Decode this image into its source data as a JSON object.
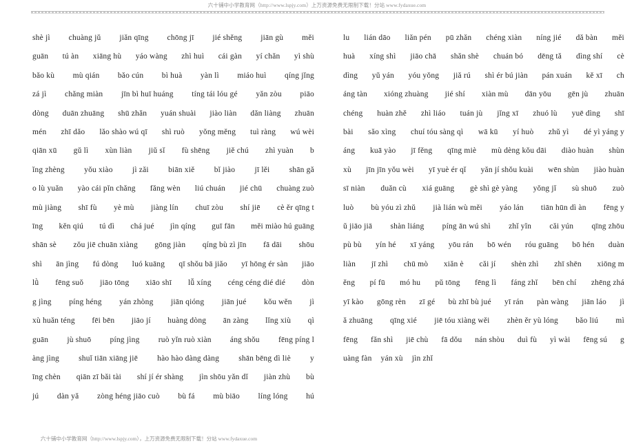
{
  "document": {
    "type": "pinyin-word-list",
    "header_banner": "六十铺中小学教育网（http://www.lspjy.com）上万资源免费无限制下载！分站 www.fydaxue.com",
    "footer_banner": "六十铺中小学教育网（http://www.lspjy.com），上万资源免费无限制下载！分站 www.fydaxue.com"
  },
  "columns": {
    "left": {
      "lines": [
        [
          "shè jì",
          "chuàng jǔ",
          "jiǎn qīng",
          "chōng jī",
          "jié shěng",
          "jiān gù",
          "měi"
        ],
        [
          "guān",
          "tú àn",
          "xiāng hù",
          "yáo wàng",
          "zhì huì",
          "cái gàn",
          "yí chǎn",
          "yì shù"
        ],
        [
          "bǎo kù",
          "mù qián",
          "bǎo cún",
          "bì huà",
          "yàn lì",
          "miáo huì",
          "qíng jǐng"
        ],
        [
          "zá jì",
          "chǎng miàn",
          "jīn bì huī huáng",
          "tíng tái lóu gé",
          "yǎn zòu",
          "piāo"
        ],
        [
          "dòng",
          "duān zhuāng",
          "shū zhǎn",
          "yuán shuài",
          "jiào liàn",
          "dǎn liàng",
          "zhuān"
        ],
        [
          "mén",
          "zhī dǎo",
          "lǎo shào wú qī",
          "shì ruò",
          "yǒng měng",
          "tuì ràng",
          "wú wèi"
        ],
        [
          "qiān xū",
          "gǔ lì",
          "xùn liàn",
          "jiǔ sǐ",
          "fù shēng",
          "jiě chú",
          "zhì yuàn",
          "b"
        ],
        [
          "ǐng zhèng",
          "yǒu xiào",
          "jì zǎi",
          "biān xiě",
          "bǐ jiào",
          "jī lěi",
          "shān gǎ"
        ],
        [
          "o lù yuǎn",
          "yào cái pǐn chǎng",
          "fǎng wèn",
          "liú chuán",
          "jié chū",
          "chuàng zuò"
        ],
        [
          "mù jiàng",
          "shī fù",
          "yè mù",
          "jiàng lín",
          "chuī zòu",
          "shí jiē",
          "cè ěr qīng t"
        ],
        [
          "īng",
          "kěn qiú",
          "tú dì",
          "chá jué",
          "jìn qíng",
          "guī fān",
          "měi miào hú guāng"
        ],
        [
          "shān sè",
          "zǒu jiē chuān xiàng",
          "gōng jiàn",
          "qíng bù zì jīn",
          "fā dāi",
          "shōu"
        ],
        [
          "shì",
          "ān jìng",
          "fú dòng",
          "luó kuāng",
          "qī shǒu bā jiǎo",
          "yī hōng ér sàn",
          "jiāo"
        ],
        [
          "lǜ",
          "fēng suǒ",
          "jiāo tōng",
          "xiāo shī",
          "lǚ xíng",
          "céng céng dié dié",
          "dòn"
        ],
        [
          "g jìng",
          "píng héng",
          "yán zhòng",
          "jiān qióng",
          "jiān jué",
          "kǒu wěn",
          "jì"
        ],
        [
          "xù huǎn téng",
          "fēi bēn",
          "jiāo jí",
          "huàng dòng",
          "ān zàng",
          "lǐng xiù",
          "qì"
        ],
        [
          "guān",
          "jù shuō",
          "píng jìng",
          "ruò yǐn ruò xiàn",
          "áng shǒu",
          "fēng píng l"
        ],
        [
          "àng jìng",
          "shuǐ tiān xiāng jiē",
          "hào hào dàng dàng",
          "shān bēng dì liè",
          "y"
        ],
        [
          "īng chèn",
          "qiān zī bǎi tài",
          "shí jí ér shàng",
          "jìn shōu yǎn dǐ",
          "jiàn zhù",
          "bù"
        ],
        [
          "jú",
          "dàn yǎ",
          "zòng héng jiāo cuò",
          "bù fá",
          "mù biāo",
          "líng lóng",
          "hú"
        ]
      ]
    },
    "right": {
      "lines": [
        [
          "lu",
          "lián dāo",
          "liǎn pén",
          "pū zhǎn",
          "chéng xiàn",
          "níng jié",
          "dǎ bàn",
          "měi"
        ],
        [
          "huà",
          "xíng shì",
          "jiāo chā",
          "shǎn shè",
          "chuán bó",
          "dēng tǎ",
          "dìng shí",
          "cè"
        ],
        [
          "dìng",
          "yǔ yán",
          "yóu yǒng",
          "jiǎ rú",
          "shì ér bú jiàn",
          "pán xuán",
          "kě xī",
          "ch"
        ],
        [
          "áng tàn",
          "xióng zhuàng",
          "jié shí",
          "xiàn mù",
          "dān yōu",
          "gēn jù",
          "zhuān"
        ],
        [
          "chéng",
          "huàn zhě",
          "zhì liáo",
          "tuán jù",
          "jǐng xī",
          "zhuó lù",
          "yuē dìng",
          "shī"
        ],
        [
          "bài",
          "sǎo xìng",
          "chuí tóu sàng qì",
          "wā kū",
          "yí huò",
          "zhǔ yì",
          "dé yì yáng y"
        ],
        [
          "áng",
          "kuā yào",
          "jī fěng",
          "qīng miè",
          "mù dèng kǒu dāi",
          "diào huàn",
          "shùn"
        ],
        [
          "xù",
          "jīn jīn yǒu wèi",
          "yī yuè ér qǐ",
          "yǎn jí shǒu kuài",
          "wēn shùn",
          "jiào huàn"
        ],
        [
          "sī niàn",
          "duǎn cù",
          "xiá guāng",
          "gè shì gè yàng",
          "yǒng jǐ",
          "sù shuō",
          "zuò"
        ],
        [
          "luò",
          "bù yóu zì zhǔ",
          "jià lián wù měi",
          "yáo lán",
          "tiān hūn dì àn",
          "fēng y"
        ],
        [
          "ǔ jiāo jiā",
          "shàn liáng",
          "píng ān wú shì",
          "zhǐ yǐn",
          "cǎi yún",
          "qīng zhōu"
        ],
        [
          "pù bù",
          "yín hé",
          "xī yáng",
          "yōu rán",
          "bō wén",
          "róu guāng",
          "bō hén",
          "duàn"
        ],
        [
          "liàn",
          "jī zhì",
          "chū mò",
          "xiǎn è",
          "cǎi jí",
          "shèn zhì",
          "zhī shēn",
          "xiōng m"
        ],
        [
          "ěng",
          "pí fū",
          "mó hu",
          "pǔ tōng",
          "fēng lì",
          "fáng zhǐ",
          "bēn chí",
          "zhēng zhá"
        ],
        [
          "yī kào",
          "gōng rèn",
          "zī gé",
          "bù zhī bù jué",
          "yī rán",
          "pàn wàng",
          "jiān láo",
          "jì"
        ],
        [
          "ǎ zhuāng",
          "qīng xié",
          "jiē tóu xiàng wěi",
          "zhèn ěr yù lóng",
          "bǎo liú",
          "mì"
        ],
        [
          "fēng",
          "fǎn shì",
          "jiē chù",
          "fā dǒu",
          "nán shòu",
          "duì fù",
          "yì wài",
          "fēng sú",
          "g"
        ],
        [
          "uàng fàn",
          "yán xù",
          "jìn zhǐ"
        ]
      ]
    }
  }
}
